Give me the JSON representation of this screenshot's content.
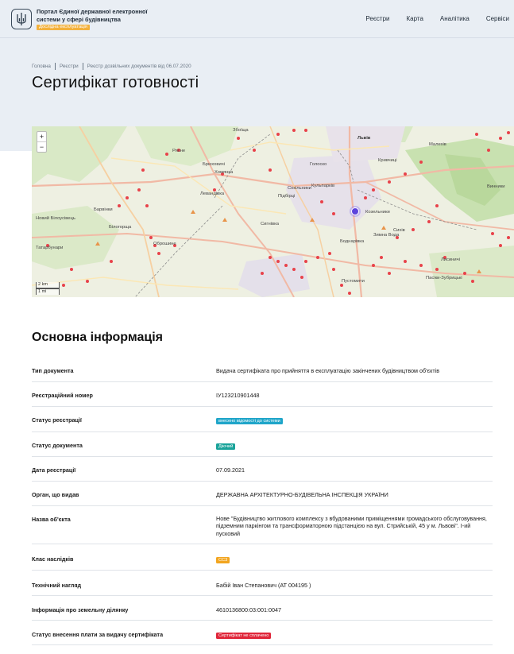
{
  "header": {
    "portal_title": "Портал Єдиної державної електронної системи у сфері будівництва",
    "beta_badge": "Дослідна експлуатація",
    "nav": [
      "Реєстри",
      "Карта",
      "Аналітика",
      "Сервіси"
    ]
  },
  "breadcrumb": [
    "Головна",
    "Реєстри",
    "Реєстр дозвільних документів від 06.07.2020"
  ],
  "page_title": "Сертифікат готовності",
  "map": {
    "zoom_in": "+",
    "zoom_out": "−",
    "scale_metric": "2 km",
    "scale_imperial": "1 mi",
    "labels": [
      "Львів",
      "Рясне",
      "Сокільники",
      "Зимна Вода",
      "Підбірці",
      "Винники",
      "Брюховичі",
      "Пустомити",
      "Сихів",
      "Оброшине",
      "Барвінки",
      "Боднарівка",
      "Кульпарків",
      "Левандівка",
      "Білогорща",
      "Сигнівка",
      "Збоїща",
      "Голоско",
      "Кривчиці",
      "Лисиничі",
      "Татарбунари",
      "Пасіки-Зубрицькі",
      "Козельники",
      "Новий Білоусівець",
      "Хомянка",
      "Малехів"
    ]
  },
  "section_title": "Основна інформація",
  "info_rows": [
    {
      "label": "Тип документа",
      "value": "Видача сертифіката про прийняття в експлуатацію закінчених будівництвом об'єктів"
    },
    {
      "label": "Реєстраційний номер",
      "value": "ІУ123210901448"
    },
    {
      "label": "Статус реєстрації",
      "badge": "внесено відомості до системи",
      "badge_color": "#1fa5c9"
    },
    {
      "label": "Статус документа",
      "badge": "Діючий",
      "badge_color": "#1aa39a"
    },
    {
      "label": "Дата реєстрації",
      "value": "07.09.2021"
    },
    {
      "label": "Орган, що видав",
      "value": "ДЕРЖАВНА АРХІТЕКТУРНО-БУДІВЕЛЬНА ІНСПЕКЦІЯ УКРАЇНИ"
    },
    {
      "label": "Назва об'єкта",
      "value": "Нове \"Будівництво житлового комплексу з вбудованими приміщеннями громадського обслуговування, підземним паркінгом та трансформаторною підстанцією на вул. Стрийській, 45 у м. Львові\". І-ий пусковий"
    },
    {
      "label": "Клас наслідків",
      "badge": "СС3",
      "badge_color": "#f2a51f"
    },
    {
      "label": "Технічний нагляд",
      "value": "Бабій Іван Степанович (АТ 004195 )"
    },
    {
      "label": "Інформація про земельну ділянку",
      "value": "4610136800:03:001:0047"
    },
    {
      "label": "Статус внесення плати за видачу сертифіката",
      "badge": "Сертифікат не сплачено",
      "badge_color": "#e0263a"
    }
  ],
  "colors": {
    "hero_bg": "#e9eef4",
    "map_bg": "#eef0e4",
    "dot": "#e8424a",
    "marker": "#6b4ee0"
  }
}
